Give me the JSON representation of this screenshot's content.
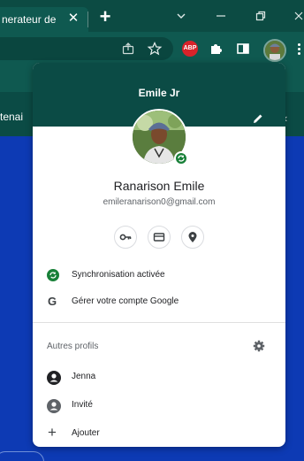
{
  "browser": {
    "tab_title": "nerateur de",
    "tab_close": "✕",
    "new_tab": "+"
  },
  "page": {
    "partial_text": "tenai",
    "chevron": "‹"
  },
  "profile_menu": {
    "header_name": "Emile Jr",
    "full_name": "Ranarison Emile",
    "email": "emileranarison0@gmail.com",
    "quick_actions": [
      "password-key-icon",
      "payment-card-icon",
      "location-pin-icon"
    ],
    "sync_label": "Synchronisation activée",
    "manage_account_label": "Gérer votre compte Google",
    "google_glyph": "G",
    "other_profiles_title": "Autres profils",
    "profiles": [
      {
        "label": "Jenna",
        "icon": "account-filled-icon"
      },
      {
        "label": "Invité",
        "icon": "guest-account-icon"
      }
    ],
    "add_label": "Ajouter",
    "add_glyph": "+"
  },
  "colors": {
    "chrome_dark_green": "#0c4b43",
    "toolbar_green": "#0f5950",
    "page_blue": "#0d3ab4",
    "sync_green": "#188038",
    "abp_red": "#d8232a"
  }
}
